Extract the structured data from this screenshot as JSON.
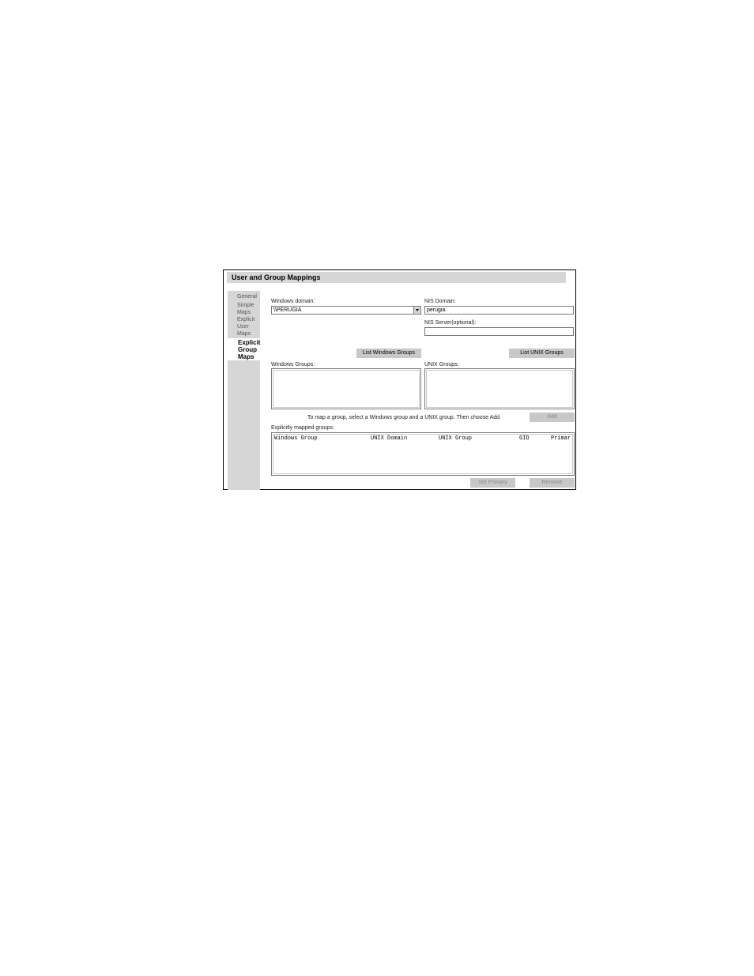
{
  "window": {
    "title": "User and Group Mappings"
  },
  "nav": {
    "items": [
      {
        "label": "General"
      },
      {
        "label": "Simple\nMaps"
      },
      {
        "label": "Explicit\nUser\nMaps"
      },
      {
        "label": "Explicit\nGroup\nMaps"
      }
    ]
  },
  "windows": {
    "domain_label": "Windows domain:",
    "domain_value": "\\\\PERUGIA",
    "groups_label": "Windows Groups:",
    "list_button": "List Windows Groups"
  },
  "nis": {
    "domain_label": "NIS Domain:",
    "domain_value": "perugia",
    "server_label": "NIS Server(optional):",
    "server_value": ""
  },
  "unix": {
    "groups_label": "UNIX Groups:",
    "list_button": "List UNIX Groups"
  },
  "mapping": {
    "instruction": "To map a group, select a Windows group and a UNIX group. Then choose Add.",
    "add_button": "Add",
    "mapped_label": "Explicitly mapped groups:",
    "columns": [
      "Windows Group",
      "UNIX Domain",
      "UNIX Group",
      "GID",
      "Primar"
    ],
    "set_primary_button": "Set Primary",
    "remove_button": "Remove"
  }
}
